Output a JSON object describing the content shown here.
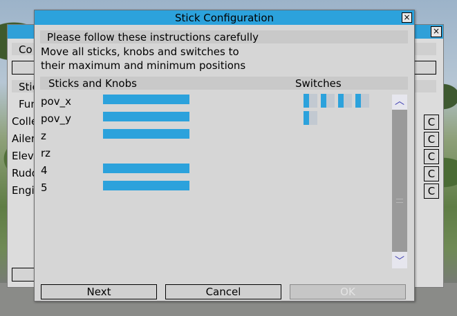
{
  "background_dialog": {
    "close_glyph": "×",
    "labels": [
      "Co",
      "Stic",
      "Fun",
      "Colle",
      "Ailer",
      "Eleva",
      "Rudd",
      "Engi"
    ],
    "c_buttons": [
      "C",
      "C",
      "C",
      "C",
      "C"
    ]
  },
  "dialog": {
    "title": "Stick Configuration",
    "close_glyph": "×",
    "instructions_header": "Please follow these instructions carefully",
    "instructions_line1": "Move all sticks, knobs and switches to",
    "instructions_line2": "their maximum and minimum positions",
    "sticks_header": "Sticks and Knobs",
    "switches_header": "Switches",
    "axes": [
      {
        "name": "pov_x",
        "level": 1
      },
      {
        "name": "pov_y",
        "level": 1
      },
      {
        "name": "z",
        "level": 1
      },
      {
        "name": "rz",
        "level": 0
      },
      {
        "name": "4",
        "level": 1
      },
      {
        "name": "5",
        "level": 1
      }
    ],
    "switch_count": 5,
    "scroll_up_glyph": "︿",
    "scroll_down_glyph": "﹀",
    "buttons": {
      "next": "Next",
      "cancel": "Cancel",
      "ok": "OK"
    },
    "colors": {
      "titlebar": "#2ca2dc",
      "bar": "#2ca2dc",
      "dialog_bg": "#d6d6d6"
    }
  }
}
